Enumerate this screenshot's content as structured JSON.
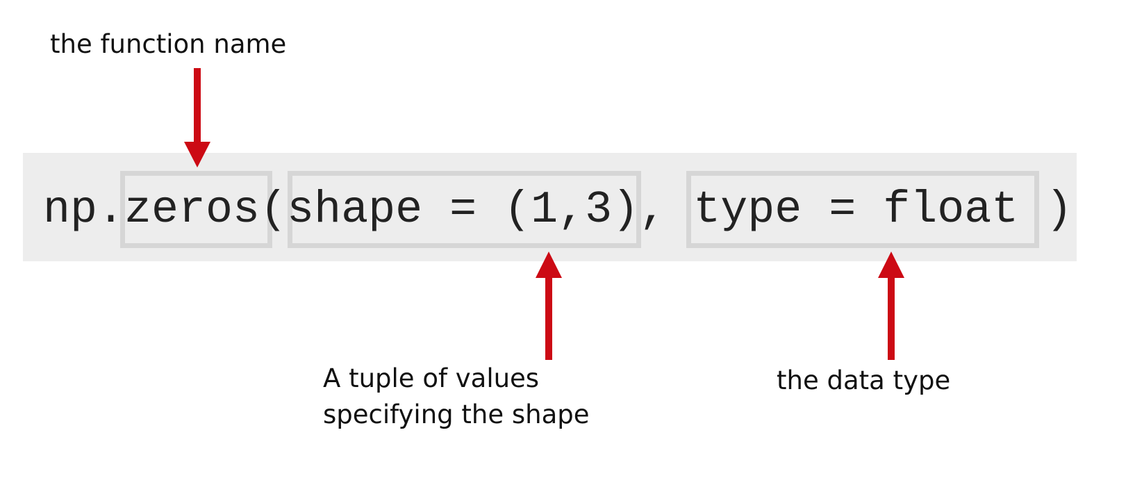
{
  "code": {
    "prefix": "np.",
    "function": "zeros",
    "open_paren": "(",
    "shape_arg": "shape = (1,3)",
    "separator": ", ",
    "type_arg": "type = float",
    "close_paren": " )"
  },
  "annotations": {
    "function_name": "the function name",
    "shape_line1": "A tuple of values",
    "shape_line2": "specifying the shape",
    "data_type": "the data type"
  },
  "colors": {
    "arrow": "#cc0a14",
    "band": "#ededed",
    "box_border": "#d6d6d6"
  }
}
